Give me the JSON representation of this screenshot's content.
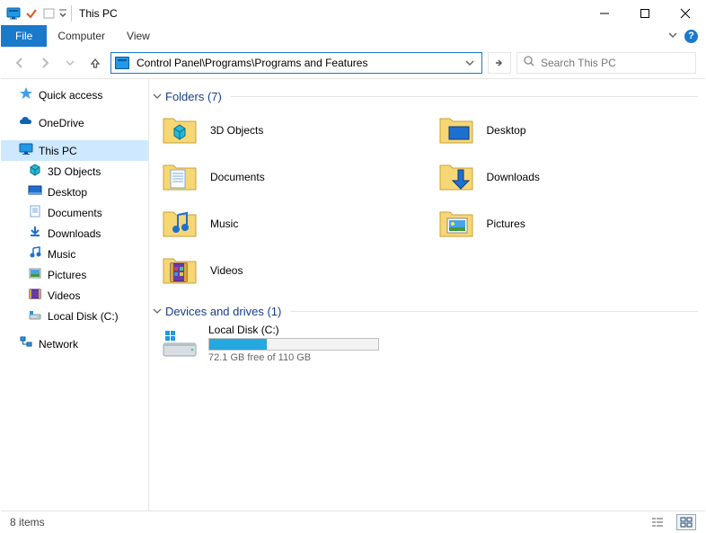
{
  "window": {
    "title": "This PC"
  },
  "menubar": {
    "file": "File",
    "computer": "Computer",
    "view": "View"
  },
  "nav": {
    "address_value": "Control Panel\\Programs\\Programs and Features",
    "search_placeholder": "Search This PC"
  },
  "sidebar": {
    "quick_access": "Quick access",
    "onedrive": "OneDrive",
    "this_pc": "This PC",
    "children": {
      "objects3d": "3D Objects",
      "desktop": "Desktop",
      "documents": "Documents",
      "downloads": "Downloads",
      "music": "Music",
      "pictures": "Pictures",
      "videos": "Videos",
      "local_disk": "Local Disk (C:)"
    },
    "network": "Network"
  },
  "groups": {
    "folders_label": "Folders (7)",
    "drives_label": "Devices and drives (1)"
  },
  "folders": {
    "objects3d": "3D Objects",
    "desktop": "Desktop",
    "documents": "Documents",
    "downloads": "Downloads",
    "music": "Music",
    "pictures": "Pictures",
    "videos": "Videos"
  },
  "drive": {
    "name": "Local Disk (C:)",
    "free_text": "72.1 GB free of 110 GB",
    "used_pct": "34%"
  },
  "status": {
    "items_text": "8 items"
  }
}
